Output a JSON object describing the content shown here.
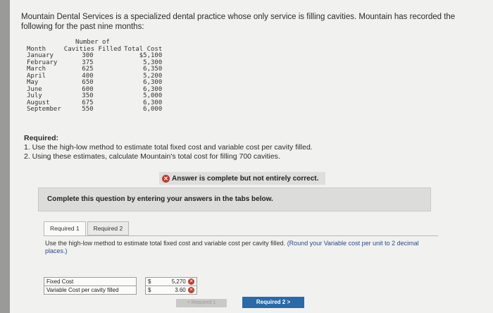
{
  "intro": "Mountain Dental Services is a specialized dental practice whose only service is filling cavities. Mountain has recorded the following for the past nine months:",
  "table": {
    "header": {
      "month": "Month",
      "cavities_line1": "Number of",
      "cavities_line2": "Cavities Filled",
      "cost": "Total Cost"
    },
    "rows": [
      {
        "month": "January",
        "cavities": "300",
        "cost": "$5,100"
      },
      {
        "month": "February",
        "cavities": "375",
        "cost": "5,300"
      },
      {
        "month": "March",
        "cavities": "625",
        "cost": "6,350"
      },
      {
        "month": "April",
        "cavities": "400",
        "cost": "5,200"
      },
      {
        "month": "May",
        "cavities": "650",
        "cost": "6,300"
      },
      {
        "month": "June",
        "cavities": "600",
        "cost": "6,300"
      },
      {
        "month": "July",
        "cavities": "350",
        "cost": "5,000"
      },
      {
        "month": "August",
        "cavities": "675",
        "cost": "6,300"
      },
      {
        "month": "September",
        "cavities": "550",
        "cost": "6,000"
      }
    ]
  },
  "required": {
    "heading": "Required:",
    "item1": "1. Use the high-low method to estimate total fixed cost and variable cost per cavity filled.",
    "item2": "2. Using these estimates, calculate Mountain's total cost for filling 700 cavities."
  },
  "status": {
    "icon": "x-circle-icon",
    "text": "Answer is complete but not entirely correct."
  },
  "instruction": "Complete this question by entering your answers in the tabs below.",
  "tabs": [
    {
      "label": "Required 1"
    },
    {
      "label": "Required 2"
    }
  ],
  "task": {
    "text": "Use the high-low method to estimate total fixed cost and variable cost per cavity filled.",
    "note": "(Round your Variable cost per unit to 2 decimal places.)"
  },
  "answers": [
    {
      "label": "Fixed Cost",
      "currency": "$",
      "value": "5,270"
    },
    {
      "label": "Variable Cost per cavity filled",
      "currency": "$",
      "value": "3.60"
    }
  ],
  "nav": {
    "prev": "< Required 1",
    "next": "Required 2  >"
  },
  "colors": {
    "error": "#c0392b",
    "next_button": "#2a6aa8"
  }
}
